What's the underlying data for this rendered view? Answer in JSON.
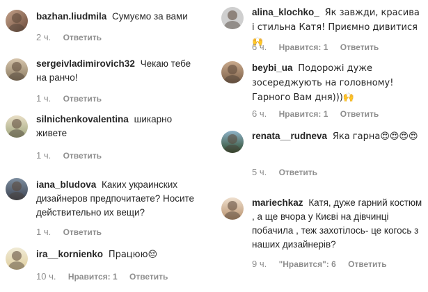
{
  "left_comments": [
    {
      "user": "bazhan.liudmila",
      "text": "Сумуємо за вами",
      "time": "2 ч.",
      "reply": "Ответить",
      "likes": ""
    },
    {
      "user": "sergeivladimirovich32",
      "text": "Чекаю тебе на ранчо!",
      "time": "1 ч.",
      "reply": "Ответить",
      "likes": ""
    },
    {
      "user": "silnichenkovalentina",
      "text": "шикарно живете",
      "time": "1 ч.",
      "reply": "Ответить",
      "likes": ""
    },
    {
      "user": "iana_bludova",
      "text": "Каких украинских дизайнеров предпочитаете? Носите действительно их вещи?",
      "time": "1 ч.",
      "reply": "Ответить",
      "likes": ""
    },
    {
      "user": "ira__kornienko",
      "text": "Працюю😔",
      "time": "10 ч.",
      "reply": "Ответить",
      "likes": "Нравится: 1"
    }
  ],
  "right_comments": [
    {
      "user": "alina_klochko_",
      "text": "Як завжди, красива і стильна Катя! Приємно дивитися🙌",
      "time": "6 ч.",
      "reply": "Ответить",
      "likes": "Нравится: 1"
    },
    {
      "user": "beybi_ua",
      "text": "Подорожі дуже зосереджують на головному! Гарного Вам дня)))🙌",
      "time": "6 ч.",
      "reply": "Ответить",
      "likes": "Нравится: 1"
    },
    {
      "user": "renata__rudneva",
      "text": "Яка гарна😍😍😍😍",
      "time": "5 ч.",
      "reply": "Ответить",
      "likes": ""
    },
    {
      "user": "mariechkaz",
      "text": "Катя, дуже гарний костюм , а ще вчора у Києві на дівчинці побачила , теж захотілось- це когось з наших дизайнерів?",
      "time": "9 ч.",
      "reply": "Ответить",
      "likes": "\"Нравится\": 6"
    }
  ]
}
